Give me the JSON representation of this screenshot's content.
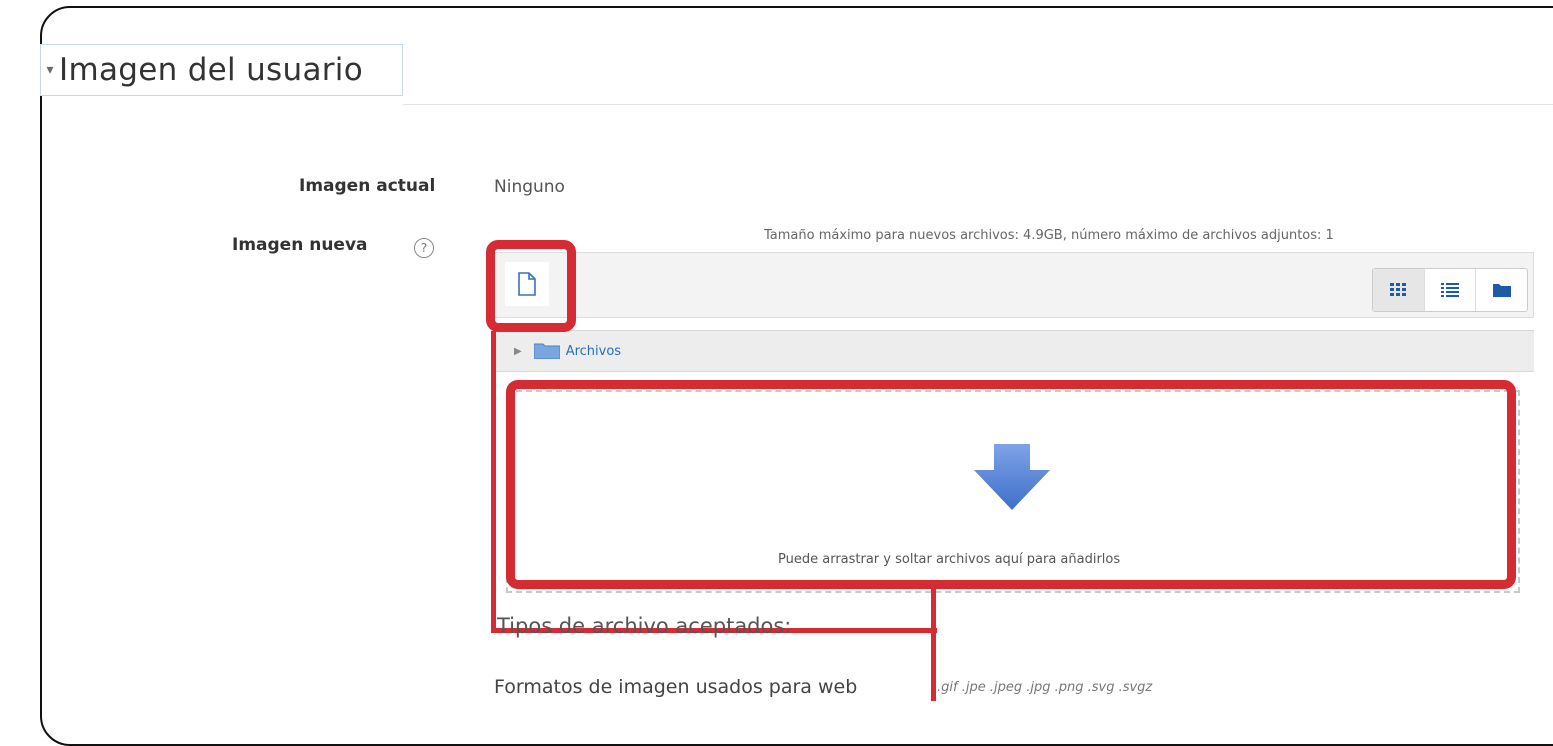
{
  "section": {
    "title": "Imagen del usuario"
  },
  "fields": {
    "current_image": {
      "label": "Imagen actual",
      "value": "Ninguno"
    },
    "new_image": {
      "label": "Imagen nueva",
      "help_symbol": "?"
    }
  },
  "filepicker": {
    "limits_text": "Tamaño máximo para nuevos archivos: 4.9GB, número máximo de archivos adjuntos: 1",
    "path_label": "Archivos",
    "dropzone_text": "Puede arrastrar y soltar archivos aquí para añadirlos",
    "view_modes": [
      "grid-icon",
      "list-icon",
      "folder-icon"
    ]
  },
  "accepted": {
    "title": "Tipos de archivo aceptados:",
    "formats_label": "Formatos de imagen usados para web",
    "formats_list": ".gif .jpe .jpeg .jpg .png .svg .svgz"
  },
  "colors": {
    "highlight": "#d52b33",
    "arrow": "#5b86d6",
    "link": "#2a6ebb"
  }
}
